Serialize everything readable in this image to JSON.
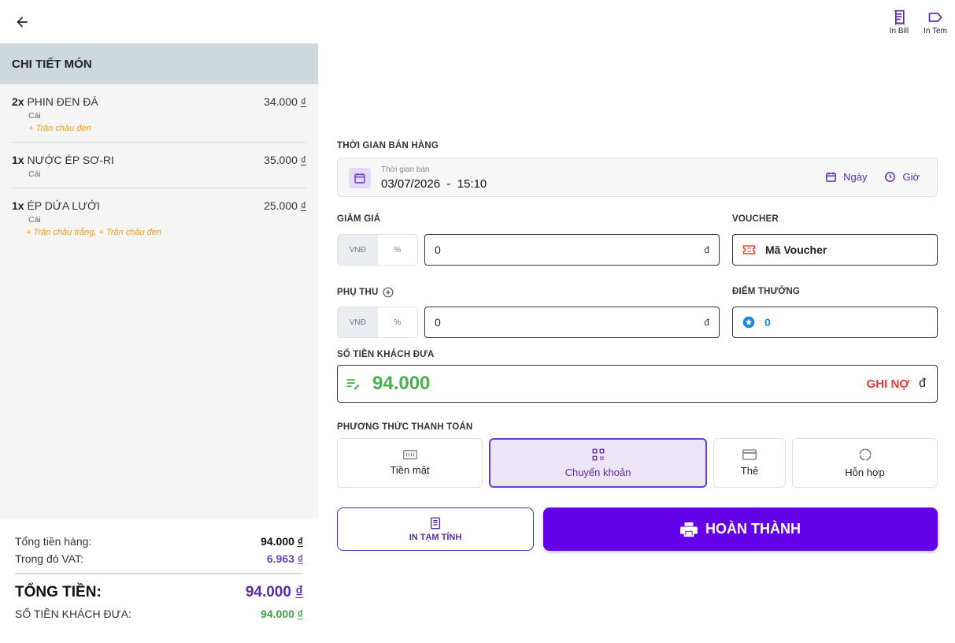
{
  "topbar": {
    "actions": [
      {
        "label": "In Bill",
        "icon": "receipt-icon"
      },
      {
        "label": "In Tem",
        "icon": "label-tag-icon"
      }
    ]
  },
  "order": {
    "header": "CHI TIẾT MÓN",
    "items": [
      {
        "qty": "2x",
        "name": "PHIN ĐEN ĐÁ",
        "unit": "Cái",
        "price": "34.000",
        "currency": "₫",
        "topping": "+ Trân châu đen"
      },
      {
        "qty": "1x",
        "name": "NƯỚC ÉP SƠ-RI",
        "unit": "Cái",
        "price": "35.000",
        "currency": "₫",
        "topping": ""
      },
      {
        "qty": "1x",
        "name": "ÉP DỨA LƯỚI",
        "unit": "Cái",
        "price": "25.000",
        "currency": "₫",
        "topping": "+ Trân châu trắng, + Trân châu đen"
      }
    ]
  },
  "summary": {
    "subtotal_label": "Tổng tiền hàng:",
    "subtotal_value": "94.000",
    "vat_label": "Trong đó VAT:",
    "vat_value": "6.963",
    "total_label": "TỔNG TIỀN:",
    "total_value": "94.000",
    "paid_label": "SỐ TIỀN KHÁCH ĐƯA:",
    "paid_value": "94.000",
    "currency": "₫"
  },
  "sale_time": {
    "label": "THỜI GIAN BÁN HÀNG",
    "sub_label": "Thời gian bán",
    "value": "03/07/2026  -  15:10",
    "day_button": "Ngày",
    "time_button": "Giờ"
  },
  "discount": {
    "label": "GIẢM GIÁ",
    "unit_options": [
      "VNĐ",
      "%"
    ],
    "value": "0",
    "suffix": "đ"
  },
  "voucher": {
    "label": "VOUCHER",
    "placeholder": "Mã Voucher"
  },
  "surcharge": {
    "label": "PHỤ THU",
    "unit_options": [
      "VNĐ",
      "%"
    ],
    "value": "0",
    "suffix": "đ"
  },
  "points": {
    "label": "ĐIỂM THƯỞNG",
    "value": "0"
  },
  "customer_paid": {
    "label": "SỐ TIỀN KHÁCH ĐƯA",
    "amount": "94.000",
    "debt_label": "GHI NỢ",
    "currency": "đ"
  },
  "payment": {
    "label": "PHƯƠNG THỨC THANH TOÁN",
    "methods": [
      {
        "label": "Tiền mặt",
        "icon": "cash-icon",
        "selected": false
      },
      {
        "label": "Chuyển khoản",
        "icon": "qr-code-icon",
        "selected": true
      },
      {
        "label": "Thẻ",
        "icon": "credit-card-icon",
        "selected": false
      },
      {
        "label": "Hỗn hợp",
        "icon": "mixed-circle-icon",
        "selected": false
      }
    ]
  },
  "actions": {
    "print_temp": "IN TẠM TÍNH",
    "finish": "HOÀN THÀNH"
  },
  "colors": {
    "primary": "#6200ea",
    "accent_purple": "#5b2ba6",
    "success_green": "#4caf50",
    "debt_red": "#e53935",
    "topping_orange": "#f29c11"
  }
}
